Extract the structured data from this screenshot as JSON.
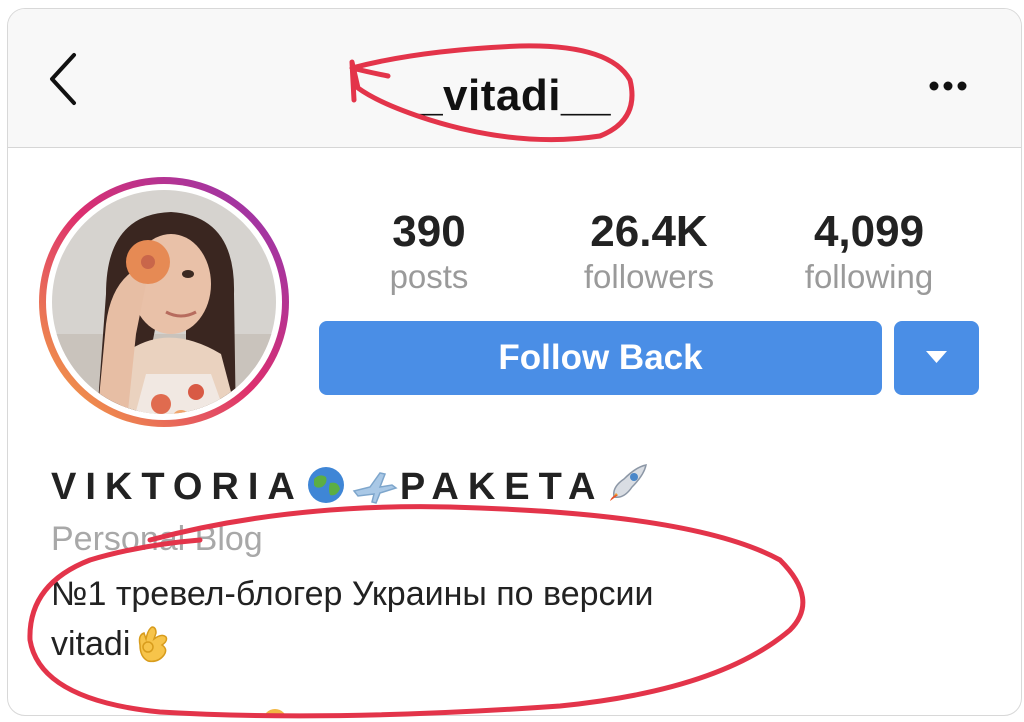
{
  "header": {
    "username": "_vitadi__",
    "icons": {
      "back": "chevron-left-icon",
      "more": "more-options-icon"
    }
  },
  "stats": {
    "posts": {
      "value": "390",
      "label": "posts"
    },
    "followers": {
      "value": "26.4K",
      "label": "followers"
    },
    "following": {
      "value": "4,099",
      "label": "following"
    }
  },
  "actions": {
    "follow_back_label": "Follow Back",
    "dropdown_icon": "triangle-down-icon"
  },
  "profile": {
    "name_part1": "VIKTORIA",
    "name_part2": "PAKETA",
    "name_emojis": [
      "globe-icon",
      "airplane-icon",
      "rocket-icon"
    ],
    "category": "Personal Blog",
    "bio_line1": "№1 тревел-блогер Украины по версии",
    "bio_line2": "vitadi",
    "bio_emoji": "ok-hand-icon"
  },
  "colors": {
    "accent_blue": "#4a8ee6",
    "annotation_red": "#e3344a",
    "ring_gradient": [
      "#f4a23a",
      "#d8316d",
      "#8b3ab8"
    ]
  }
}
